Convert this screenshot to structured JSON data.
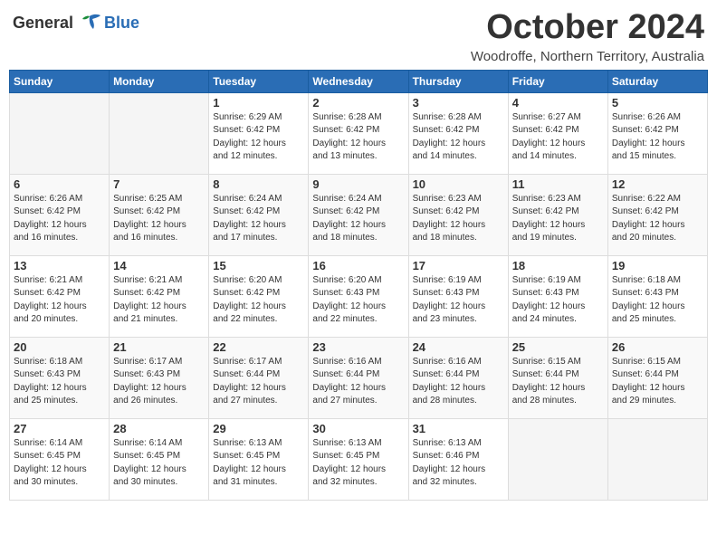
{
  "header": {
    "logo_general": "General",
    "logo_blue": "Blue",
    "month_title": "October 2024",
    "location": "Woodroffe, Northern Territory, Australia"
  },
  "days_of_week": [
    "Sunday",
    "Monday",
    "Tuesday",
    "Wednesday",
    "Thursday",
    "Friday",
    "Saturday"
  ],
  "weeks": [
    [
      {
        "day": "",
        "info": ""
      },
      {
        "day": "",
        "info": ""
      },
      {
        "day": "1",
        "info": "Sunrise: 6:29 AM\nSunset: 6:42 PM\nDaylight: 12 hours\nand 12 minutes."
      },
      {
        "day": "2",
        "info": "Sunrise: 6:28 AM\nSunset: 6:42 PM\nDaylight: 12 hours\nand 13 minutes."
      },
      {
        "day": "3",
        "info": "Sunrise: 6:28 AM\nSunset: 6:42 PM\nDaylight: 12 hours\nand 14 minutes."
      },
      {
        "day": "4",
        "info": "Sunrise: 6:27 AM\nSunset: 6:42 PM\nDaylight: 12 hours\nand 14 minutes."
      },
      {
        "day": "5",
        "info": "Sunrise: 6:26 AM\nSunset: 6:42 PM\nDaylight: 12 hours\nand 15 minutes."
      }
    ],
    [
      {
        "day": "6",
        "info": "Sunrise: 6:26 AM\nSunset: 6:42 PM\nDaylight: 12 hours\nand 16 minutes."
      },
      {
        "day": "7",
        "info": "Sunrise: 6:25 AM\nSunset: 6:42 PM\nDaylight: 12 hours\nand 16 minutes."
      },
      {
        "day": "8",
        "info": "Sunrise: 6:24 AM\nSunset: 6:42 PM\nDaylight: 12 hours\nand 17 minutes."
      },
      {
        "day": "9",
        "info": "Sunrise: 6:24 AM\nSunset: 6:42 PM\nDaylight: 12 hours\nand 18 minutes."
      },
      {
        "day": "10",
        "info": "Sunrise: 6:23 AM\nSunset: 6:42 PM\nDaylight: 12 hours\nand 18 minutes."
      },
      {
        "day": "11",
        "info": "Sunrise: 6:23 AM\nSunset: 6:42 PM\nDaylight: 12 hours\nand 19 minutes."
      },
      {
        "day": "12",
        "info": "Sunrise: 6:22 AM\nSunset: 6:42 PM\nDaylight: 12 hours\nand 20 minutes."
      }
    ],
    [
      {
        "day": "13",
        "info": "Sunrise: 6:21 AM\nSunset: 6:42 PM\nDaylight: 12 hours\nand 20 minutes."
      },
      {
        "day": "14",
        "info": "Sunrise: 6:21 AM\nSunset: 6:42 PM\nDaylight: 12 hours\nand 21 minutes."
      },
      {
        "day": "15",
        "info": "Sunrise: 6:20 AM\nSunset: 6:42 PM\nDaylight: 12 hours\nand 22 minutes."
      },
      {
        "day": "16",
        "info": "Sunrise: 6:20 AM\nSunset: 6:43 PM\nDaylight: 12 hours\nand 22 minutes."
      },
      {
        "day": "17",
        "info": "Sunrise: 6:19 AM\nSunset: 6:43 PM\nDaylight: 12 hours\nand 23 minutes."
      },
      {
        "day": "18",
        "info": "Sunrise: 6:19 AM\nSunset: 6:43 PM\nDaylight: 12 hours\nand 24 minutes."
      },
      {
        "day": "19",
        "info": "Sunrise: 6:18 AM\nSunset: 6:43 PM\nDaylight: 12 hours\nand 25 minutes."
      }
    ],
    [
      {
        "day": "20",
        "info": "Sunrise: 6:18 AM\nSunset: 6:43 PM\nDaylight: 12 hours\nand 25 minutes."
      },
      {
        "day": "21",
        "info": "Sunrise: 6:17 AM\nSunset: 6:43 PM\nDaylight: 12 hours\nand 26 minutes."
      },
      {
        "day": "22",
        "info": "Sunrise: 6:17 AM\nSunset: 6:44 PM\nDaylight: 12 hours\nand 27 minutes."
      },
      {
        "day": "23",
        "info": "Sunrise: 6:16 AM\nSunset: 6:44 PM\nDaylight: 12 hours\nand 27 minutes."
      },
      {
        "day": "24",
        "info": "Sunrise: 6:16 AM\nSunset: 6:44 PM\nDaylight: 12 hours\nand 28 minutes."
      },
      {
        "day": "25",
        "info": "Sunrise: 6:15 AM\nSunset: 6:44 PM\nDaylight: 12 hours\nand 28 minutes."
      },
      {
        "day": "26",
        "info": "Sunrise: 6:15 AM\nSunset: 6:44 PM\nDaylight: 12 hours\nand 29 minutes."
      }
    ],
    [
      {
        "day": "27",
        "info": "Sunrise: 6:14 AM\nSunset: 6:45 PM\nDaylight: 12 hours\nand 30 minutes."
      },
      {
        "day": "28",
        "info": "Sunrise: 6:14 AM\nSunset: 6:45 PM\nDaylight: 12 hours\nand 30 minutes."
      },
      {
        "day": "29",
        "info": "Sunrise: 6:13 AM\nSunset: 6:45 PM\nDaylight: 12 hours\nand 31 minutes."
      },
      {
        "day": "30",
        "info": "Sunrise: 6:13 AM\nSunset: 6:45 PM\nDaylight: 12 hours\nand 32 minutes."
      },
      {
        "day": "31",
        "info": "Sunrise: 6:13 AM\nSunset: 6:46 PM\nDaylight: 12 hours\nand 32 minutes."
      },
      {
        "day": "",
        "info": ""
      },
      {
        "day": "",
        "info": ""
      }
    ]
  ]
}
